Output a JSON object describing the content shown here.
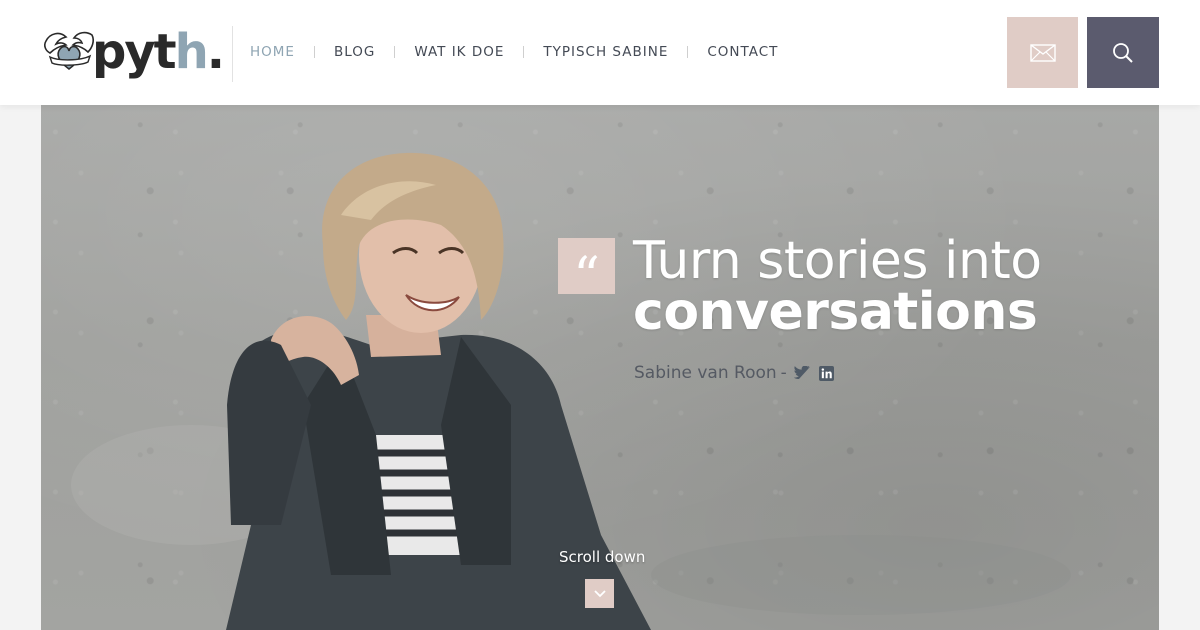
{
  "header": {
    "logo": {
      "brand_main": "pyt",
      "brand_accent": "h",
      "brand_dot": "."
    },
    "nav": [
      {
        "label": "HOME",
        "active": true
      },
      {
        "label": "BLOG",
        "active": false
      },
      {
        "label": "WAT IK DOE",
        "active": false
      },
      {
        "label": "TYPISCH SABINE",
        "active": false
      },
      {
        "label": "CONTACT",
        "active": false
      }
    ],
    "mail_button_icon": "envelope-icon",
    "search_button_icon": "search-icon"
  },
  "hero": {
    "quote_mark": "“",
    "headline_line1": "Turn stories into",
    "headline_line2": "conversations",
    "author_name": "Sabine van Roon",
    "author_dash": "-",
    "social_icons": [
      "twitter-icon",
      "linkedin-icon"
    ],
    "scroll_label": "Scroll down",
    "scroll_icon": "chevron-down-icon"
  },
  "colors": {
    "accent_pink": "#e0ccc6",
    "accent_slate": "#5b5b6e",
    "nav_active": "#8fa5b3",
    "nav_text": "#444a55"
  }
}
